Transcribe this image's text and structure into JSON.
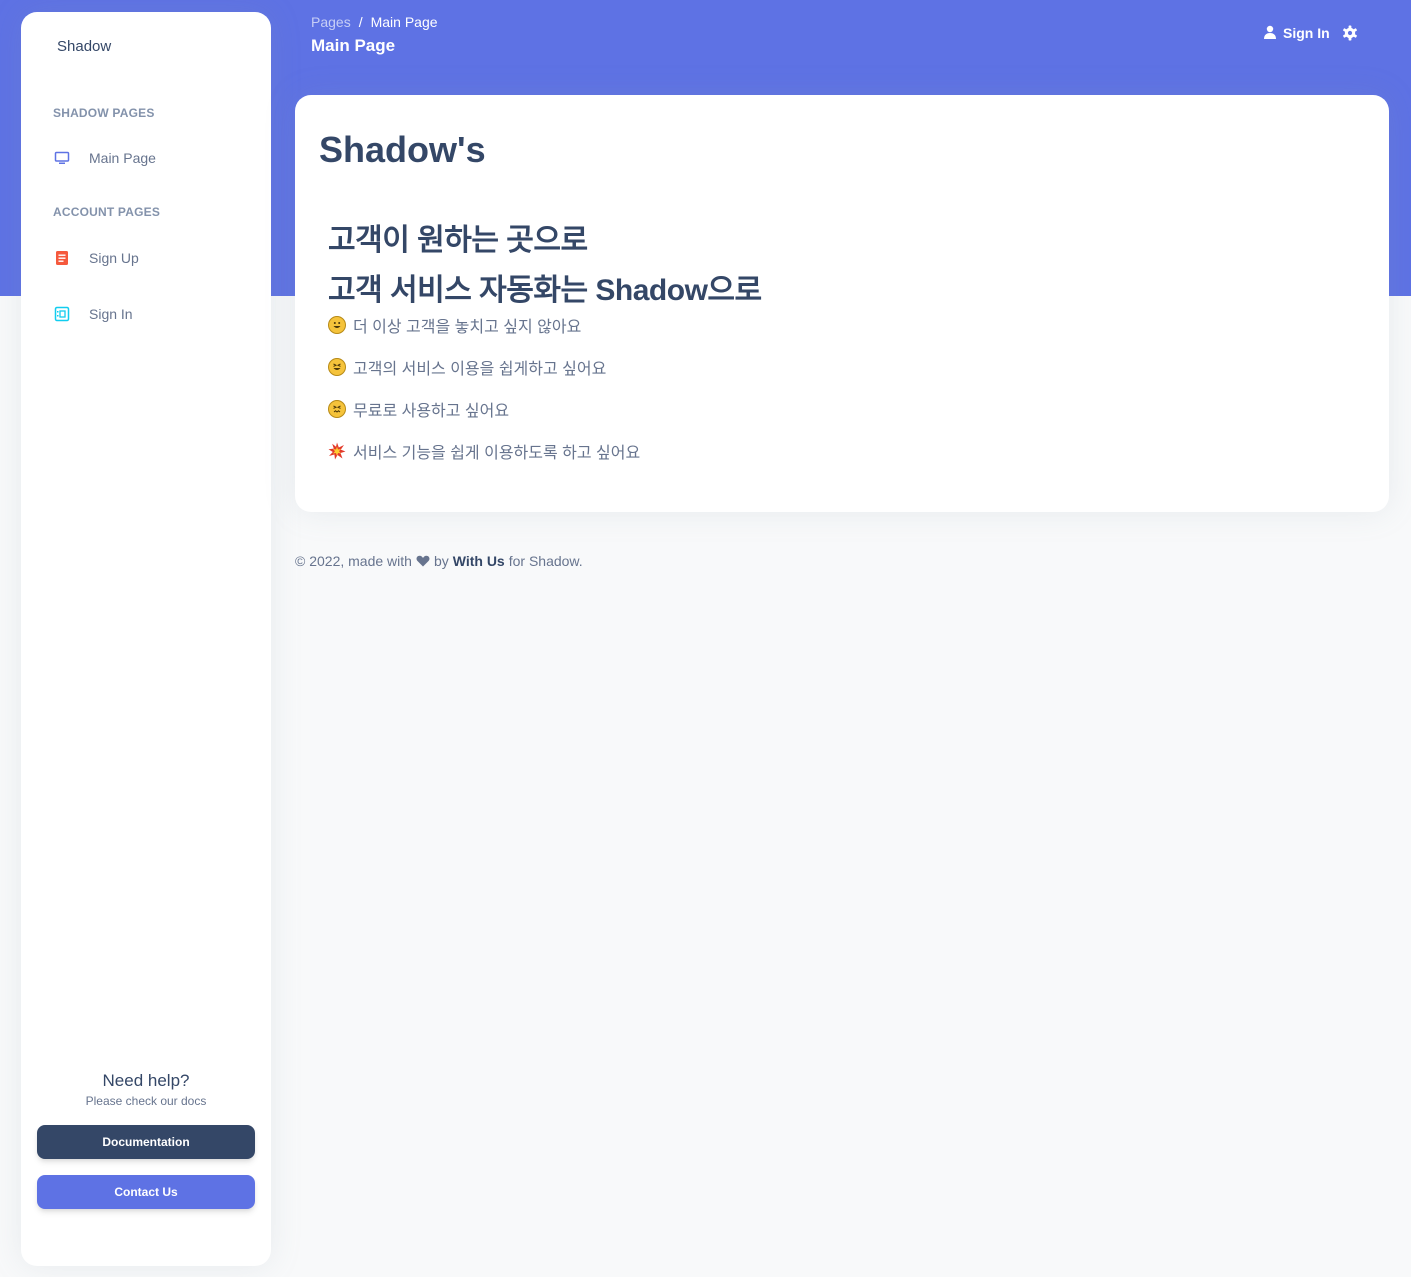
{
  "sidebar": {
    "brand": "Shadow",
    "sections": [
      {
        "title": "SHADOW PAGES",
        "items": [
          {
            "label": "Main Page",
            "icon": "monitor-icon"
          }
        ]
      },
      {
        "title": "ACCOUNT PAGES",
        "items": [
          {
            "label": "Sign Up",
            "icon": "document-icon"
          },
          {
            "label": "Sign In",
            "icon": "id-card-icon"
          }
        ]
      }
    ],
    "help": {
      "title": "Need help?",
      "subtitle": "Please check our docs",
      "doc_button": "Documentation",
      "contact_button": "Contact Us"
    }
  },
  "navbar": {
    "breadcrumb_root": "Pages",
    "breadcrumb_sep": "/",
    "breadcrumb_current": "Main Page",
    "page_title": "Main Page",
    "signin_label": "Sign In"
  },
  "main": {
    "card_title": "Shadow's",
    "headline_1": "고객이 원하는 곳으로",
    "headline_2": "고객 서비스 자동화는 Shadow으로",
    "features": [
      {
        "emoji": "grinning-face-icon",
        "text": "더 이상 고객을 놓치고 싶지 않아요"
      },
      {
        "emoji": "squinting-face-icon",
        "text": "고객의 서비스 이용을 쉽게하고 싶어요"
      },
      {
        "emoji": "confounded-face-icon",
        "text": "무료로 사용하고 싶어요"
      },
      {
        "emoji": "collision-icon",
        "text": "서비스 기능을 쉽게 이용하도록 하고 싶어요"
      }
    ]
  },
  "footer": {
    "prefix": "© 2022, made with",
    "by": "by",
    "author": "With Us",
    "suffix": "for Shadow."
  },
  "colors": {
    "primary": "#5e72e4",
    "dark": "#344767",
    "text_muted": "#67748e",
    "background": "#f8f9fa"
  }
}
